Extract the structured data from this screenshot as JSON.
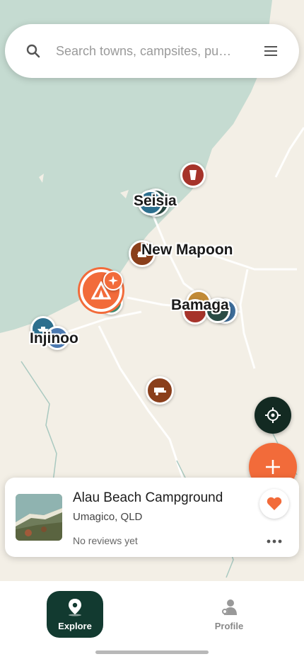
{
  "search": {
    "placeholder": "Search towns, campsites, pu…"
  },
  "towns": [
    "Seisia",
    "New Mapoon",
    "Bamaga",
    "Injinoo"
  ],
  "card": {
    "title": "Alau Beach Campground",
    "location": "Umagico, QLD",
    "reviews": "No reviews yet"
  },
  "nav": {
    "explore": "Explore",
    "profile": "Profile"
  },
  "colors": {
    "accent": "#f26b3a",
    "dark": "#132a22",
    "water": "#c5dbd1",
    "land": "#f3efe6"
  },
  "icons": {
    "search": "search-icon",
    "menu": "menu-icon",
    "locate": "crosshair-icon",
    "add": "plus-icon",
    "favorite": "heart-icon",
    "more": "more-icon"
  }
}
